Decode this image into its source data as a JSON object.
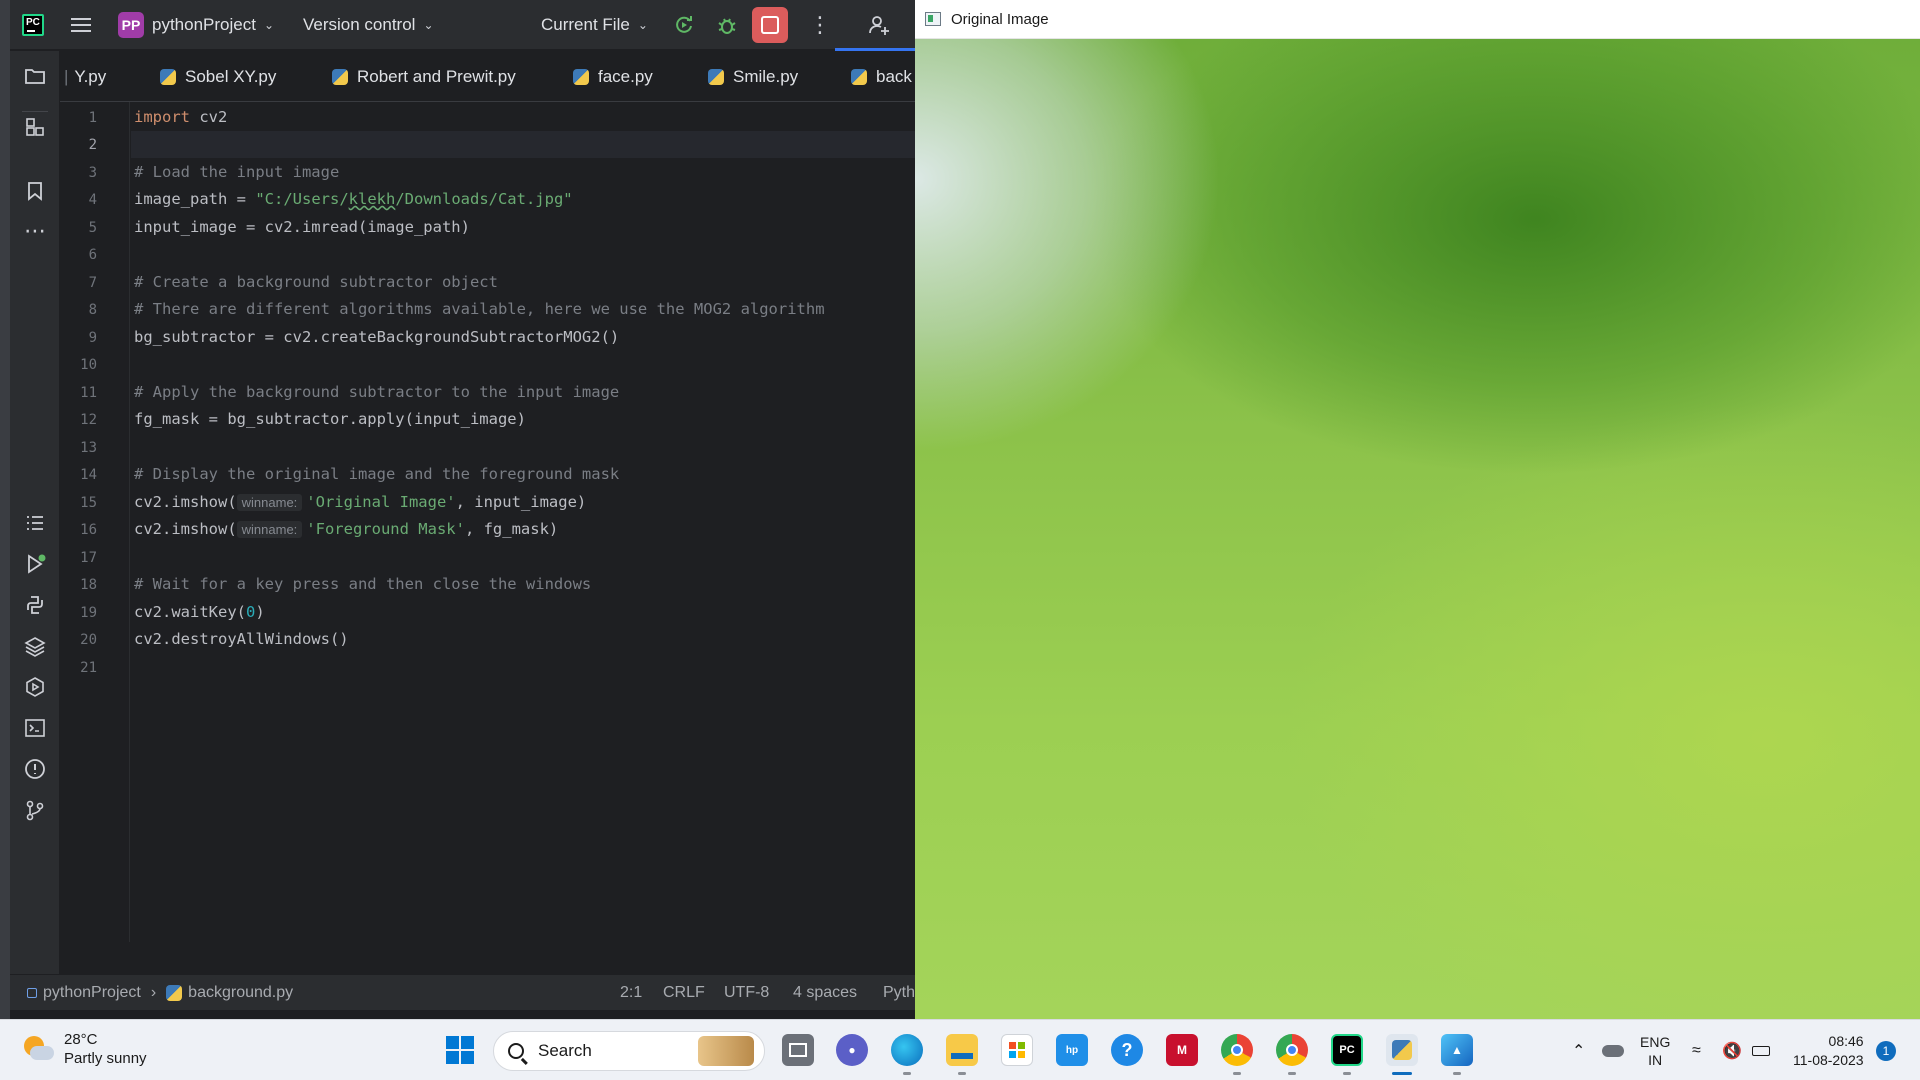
{
  "ide": {
    "project_badge": "PP",
    "project_name": "pythonProject",
    "version_control": "Version control",
    "run_config": "Current File",
    "tabs": [
      {
        "label": "Y.py"
      },
      {
        "label": "Sobel XY.py"
      },
      {
        "label": "Robert and Prewit.py"
      },
      {
        "label": "face.py"
      },
      {
        "label": "Smile.py"
      },
      {
        "label": "back"
      }
    ],
    "line_numbers": [
      "1",
      "2",
      "3",
      "4",
      "5",
      "6",
      "7",
      "8",
      "9",
      "10",
      "11",
      "12",
      "13",
      "14",
      "15",
      "16",
      "17",
      "18",
      "19",
      "20",
      "21"
    ],
    "code": {
      "l1_kw": "import",
      "l1_rest": " cv2",
      "l3": "# Load the input image",
      "l4_a": "image_path = ",
      "l4_s1": "\"C:/Users/",
      "l4_s2": "klekh",
      "l4_s3": "/Downloads/Cat.jpg\"",
      "l5": "input_image = cv2.imread(image_path)",
      "l7": "# Create a background subtractor object",
      "l8": "# There are different algorithms available, here we use the MOG2 algorithm",
      "l9": "bg_subtractor = cv2.createBackgroundSubtractorMOG2()",
      "l11": "# Apply the background subtractor to the input image",
      "l12": "fg_mask = bg_subtractor.apply(input_image)",
      "l14": "# Display the original image and the foreground mask",
      "l15_a": "cv2.imshow(",
      "l15_hint": "winname:",
      "l15_s": "'Original Image'",
      "l15_b": ", input_image)",
      "l16_a": "cv2.imshow(",
      "l16_hint": "winname:",
      "l16_s": "'Foreground Mask'",
      "l16_b": ", fg_mask)",
      "l18": "# Wait for a key press and then close the windows",
      "l19_a": "cv2.waitKey(",
      "l19_n": "0",
      "l19_b": ")",
      "l20": "cv2.destroyAllWindows()"
    },
    "status": {
      "project": "pythonProject",
      "file": "background.py",
      "position": "2:1",
      "line_sep": "CRLF",
      "encoding": "UTF-8",
      "indent": "4 spaces",
      "interpreter": "Pyth"
    },
    "tools_top": [
      "folder-icon",
      "structure-icon",
      "bookmark-icon",
      "more-icon"
    ],
    "tools_bottom": [
      "todo-icon",
      "run-icon",
      "python-console-icon",
      "layers-icon",
      "services-icon",
      "terminal-icon",
      "problems-icon",
      "git-icon"
    ]
  },
  "image_window": {
    "title": "Original Image"
  },
  "taskbar": {
    "temperature": "28°C",
    "weather": "Partly sunny",
    "search": "Search",
    "lang": "ENG",
    "region": "IN",
    "time": "08:46",
    "date": "11-08-2023",
    "notification_count": "1"
  },
  "colors": {
    "ide_bg": "#1e1f22",
    "accent": "#3574f0",
    "keyword": "#cf8e6d",
    "comment": "#7a7e85",
    "string": "#6aab73"
  }
}
